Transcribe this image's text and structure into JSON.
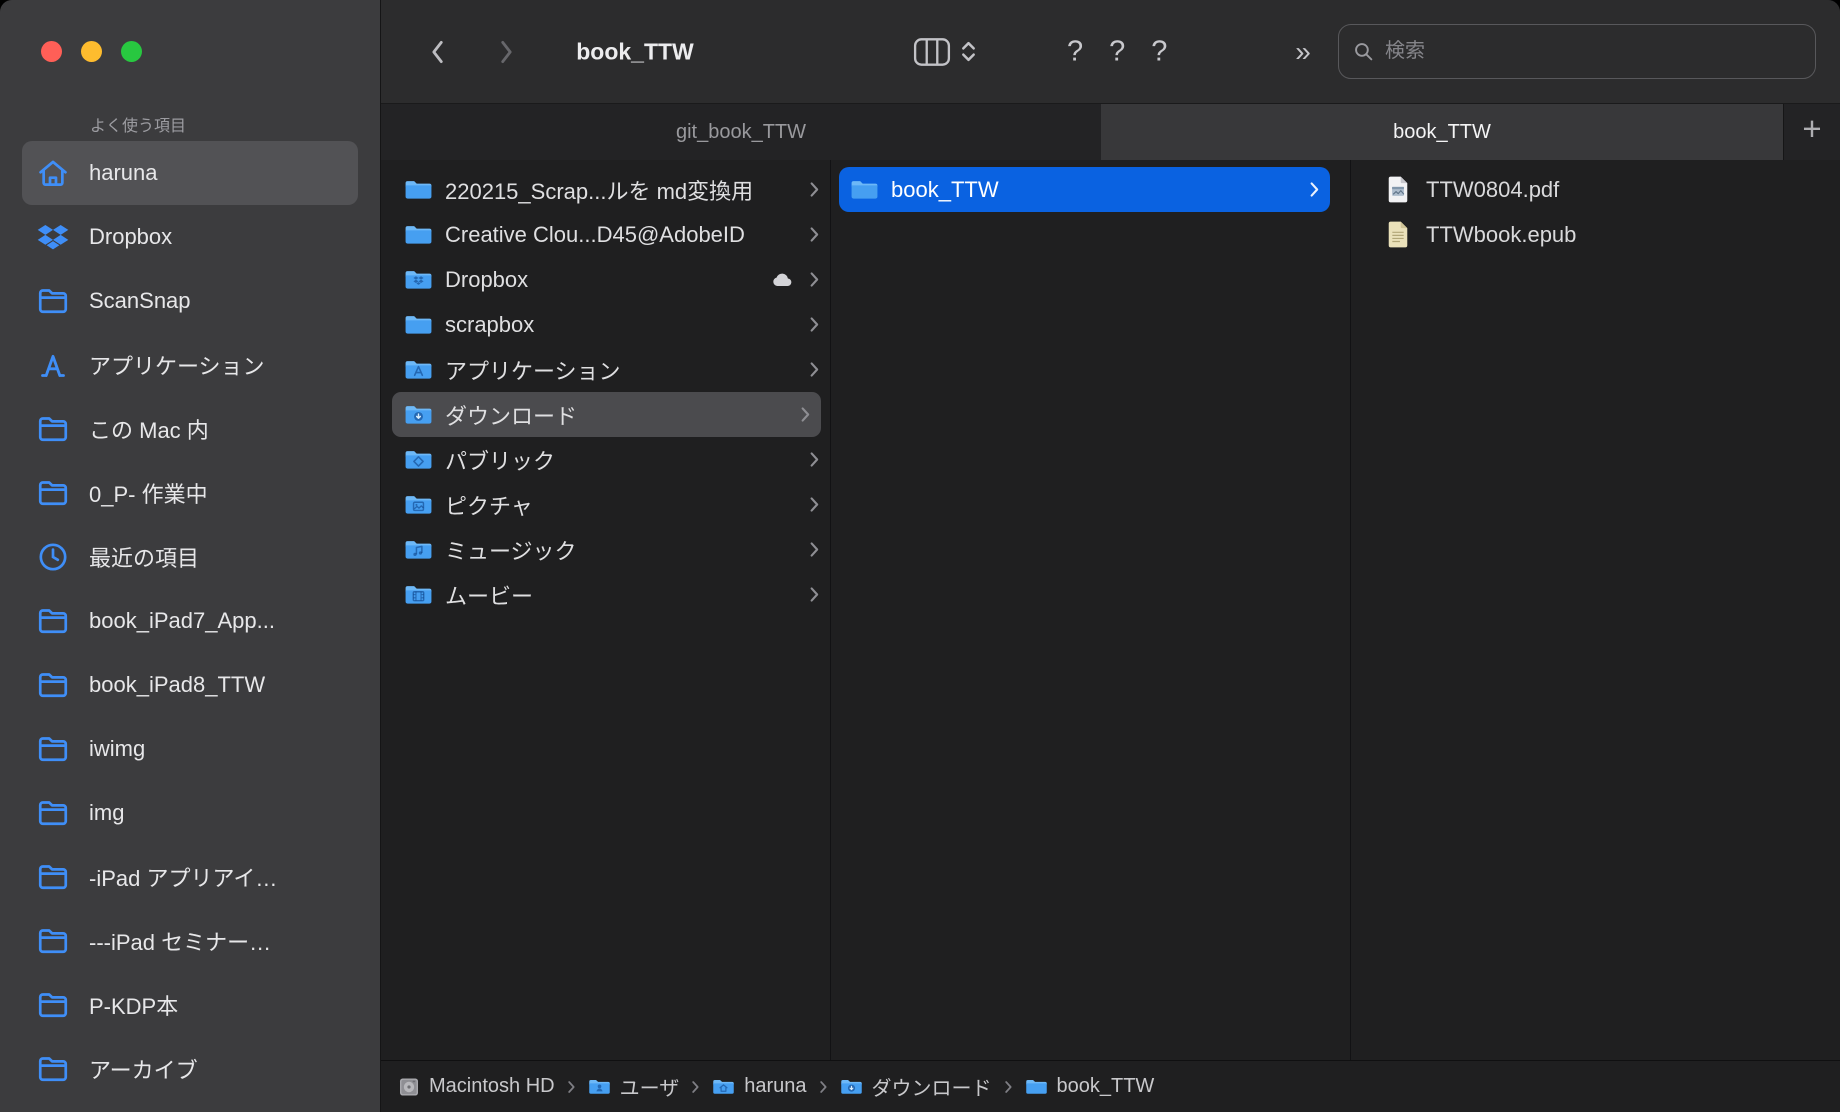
{
  "colors": {
    "accent_blue": "#0a62e1",
    "folder_blue": "#469ff1",
    "icon_blue": "#3f8ef7",
    "traffic_red": "#ff5f57",
    "traffic_yellow": "#febc2e",
    "traffic_green": "#28c840"
  },
  "titlebar": {
    "title": "book_TTW",
    "missing_icons": [
      "?",
      "?",
      "?"
    ],
    "overflow_symbol": "»",
    "search_placeholder": "検索"
  },
  "tab_bar": {
    "tabs": [
      {
        "label": "git_book_TTW",
        "active": false
      },
      {
        "label": "book_TTW",
        "active": true
      }
    ],
    "new_tab_label": "+"
  },
  "sidebar": {
    "header": "よく使う項目",
    "items": [
      {
        "label": "haruna",
        "icon": "home-icon",
        "selected": true
      },
      {
        "label": "Dropbox",
        "icon": "dropbox-icon",
        "selected": false
      },
      {
        "label": "ScanSnap",
        "icon": "folder-icon",
        "selected": false
      },
      {
        "label": "アプリケーション",
        "icon": "appstore-icon",
        "selected": false
      },
      {
        "label": "この Mac 内",
        "icon": "folder-icon",
        "selected": false
      },
      {
        "label": "0_P- 作業中",
        "icon": "folder-icon",
        "selected": false
      },
      {
        "label": "最近の項目",
        "icon": "clock-icon",
        "selected": false
      },
      {
        "label": "book_iPad7_App...",
        "icon": "folder-icon",
        "selected": false
      },
      {
        "label": "book_iPad8_TTW",
        "icon": "folder-icon",
        "selected": false
      },
      {
        "label": "iwimg",
        "icon": "folder-icon",
        "selected": false
      },
      {
        "label": "img",
        "icon": "folder-icon",
        "selected": false
      },
      {
        "label": "-iPad アプリアイ…",
        "icon": "folder-icon",
        "selected": false
      },
      {
        "label": "---iPad セミナー…",
        "icon": "folder-icon",
        "selected": false
      },
      {
        "label": "P-KDP本",
        "icon": "folder-icon",
        "selected": false
      },
      {
        "label": "アーカイブ",
        "icon": "folder-icon",
        "selected": false
      }
    ]
  },
  "columns": {
    "col1": [
      {
        "label": "220215_Scrap...ルを md変換用",
        "glyph": "none",
        "selected": false,
        "badge": ""
      },
      {
        "label": "Creative Clou...D45@AdobeID",
        "glyph": "none",
        "selected": false,
        "badge": ""
      },
      {
        "label": "Dropbox",
        "glyph": "dropbox",
        "selected": false,
        "badge": "cloud-icon"
      },
      {
        "label": "scrapbox",
        "glyph": "none",
        "selected": false,
        "badge": ""
      },
      {
        "label": "アプリケーション",
        "glyph": "appstore",
        "selected": false,
        "badge": ""
      },
      {
        "label": "ダウンロード",
        "glyph": "download",
        "selected": true,
        "badge": ""
      },
      {
        "label": "パブリック",
        "glyph": "public",
        "selected": false,
        "badge": ""
      },
      {
        "label": "ピクチャ",
        "glyph": "pictures",
        "selected": false,
        "badge": ""
      },
      {
        "label": "ミュージック",
        "glyph": "music",
        "selected": false,
        "badge": ""
      },
      {
        "label": "ムービー",
        "glyph": "movies",
        "selected": false,
        "badge": ""
      }
    ],
    "col2": [
      {
        "label": "book_TTW",
        "glyph": "none",
        "selected": true
      }
    ],
    "col3": [
      {
        "label": "TTW0804.pdf",
        "icon": "pdf-file-icon"
      },
      {
        "label": "TTWbook.epub",
        "icon": "epub-file-icon"
      }
    ]
  },
  "path_bar": [
    {
      "label": "Macintosh HD",
      "icon": "hdd-icon"
    },
    {
      "label": "ユーザ",
      "icon": "folder-users-icon"
    },
    {
      "label": "haruna",
      "icon": "folder-home-icon"
    },
    {
      "label": "ダウンロード",
      "icon": "folder-download-icon"
    },
    {
      "label": "book_TTW",
      "icon": "folder-plain-icon"
    }
  ]
}
